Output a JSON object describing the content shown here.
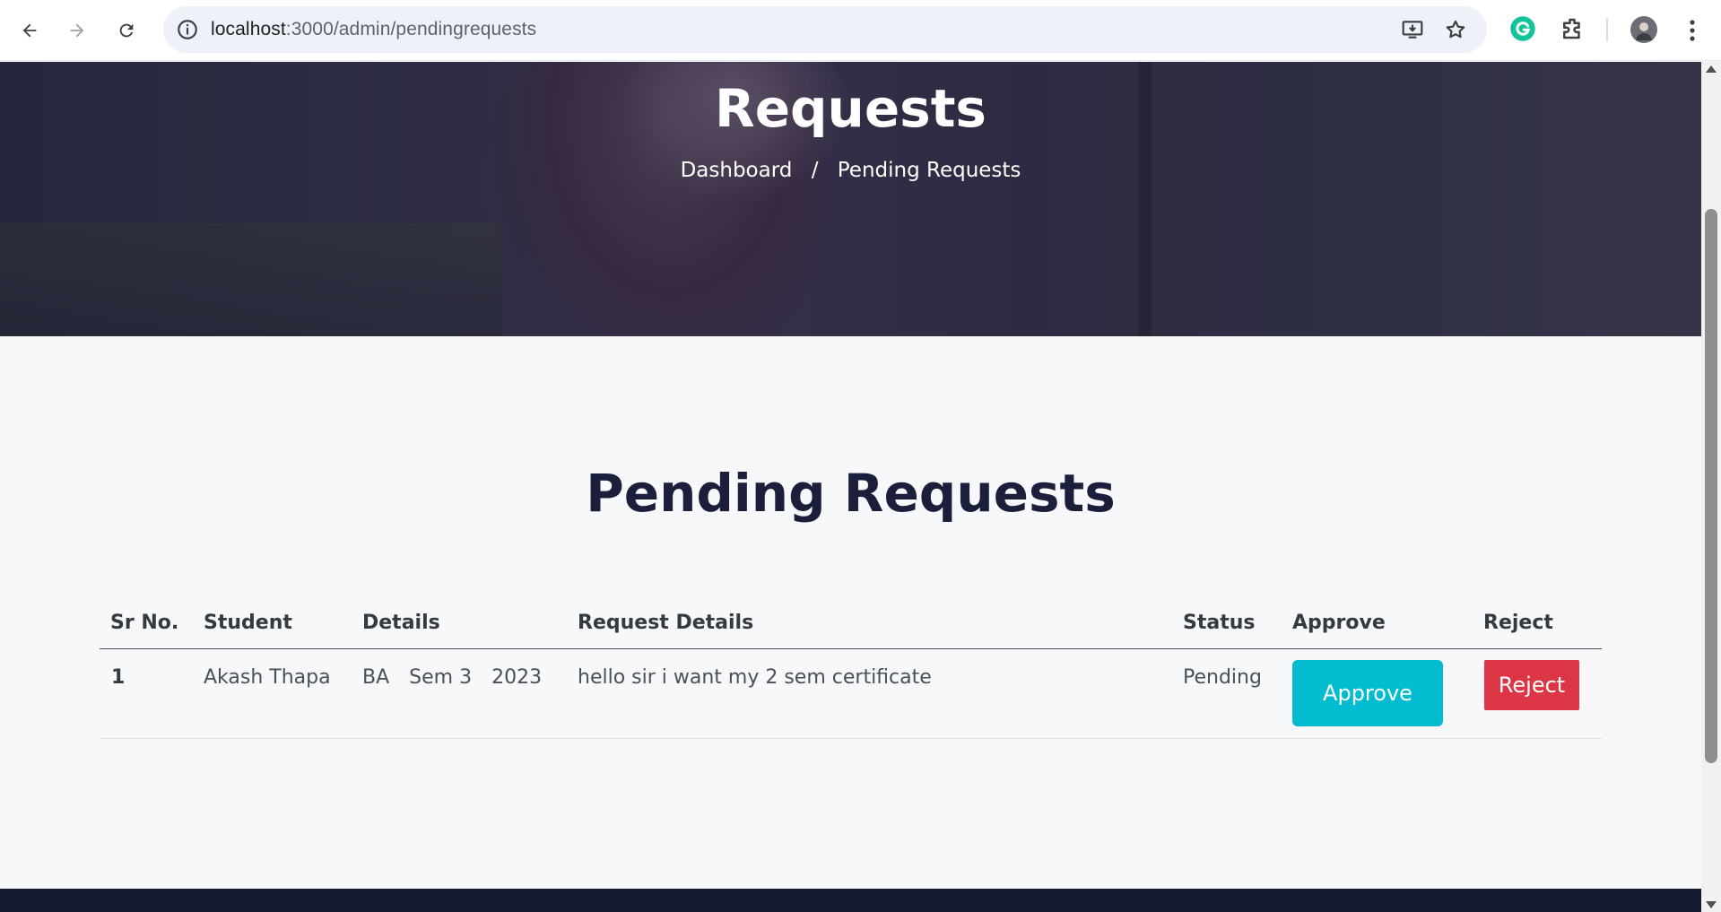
{
  "browser": {
    "url_host": "localhost",
    "url_path": ":3000/admin/pendingrequests",
    "icons": [
      "back-icon",
      "forward-icon",
      "reload-icon",
      "site-info-icon",
      "install-app-icon",
      "bookmark-star-icon",
      "grammarly-icon",
      "extensions-icon",
      "profile-avatar",
      "menu-kebab-icon"
    ]
  },
  "hero": {
    "title": "Requests",
    "breadcrumb": {
      "home": "Dashboard",
      "separator": "/",
      "current": "Pending Requests"
    }
  },
  "main": {
    "title": "Pending Requests",
    "table": {
      "headers": [
        "Sr No.",
        "Student",
        "Details",
        "Request Details",
        "Status",
        "Approve",
        "Reject"
      ],
      "rows": [
        {
          "sr": "1",
          "student": "Akash Thapa",
          "details": [
            "BA",
            "Sem 3",
            "2023"
          ],
          "request": "hello sir i want my 2 sem certificate",
          "status": "Pending",
          "approve_label": "Approve",
          "reject_label": "Reject"
        }
      ]
    }
  },
  "colors": {
    "approve": "#03bccf",
    "reject": "#dc3545",
    "footer": "#151a33",
    "title": "#1b1f3b"
  }
}
